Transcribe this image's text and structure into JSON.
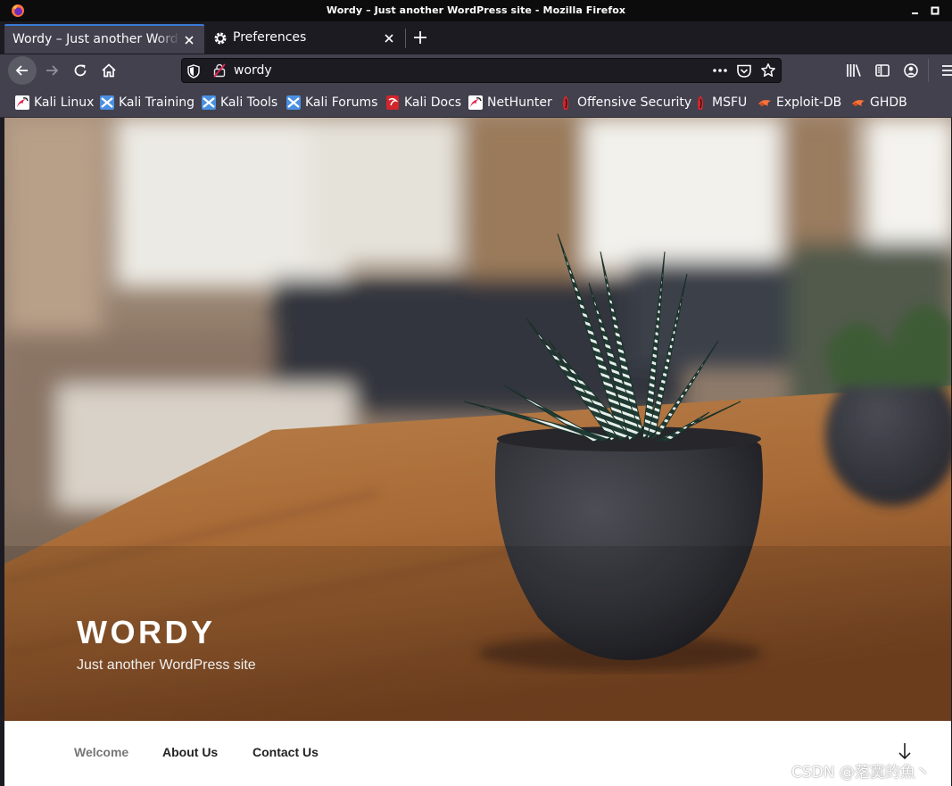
{
  "window": {
    "title": "Wordy – Just another WordPress site - Mozilla Firefox"
  },
  "tabs": [
    {
      "label": "Wordy – Just another WordPress site",
      "active": true
    },
    {
      "label": "Preferences",
      "active": false
    }
  ],
  "urlbar": {
    "value": "wordy"
  },
  "bookmarks": [
    {
      "label": "Kali Linux",
      "icon": "kali-dragon-icon"
    },
    {
      "label": "Kali Training",
      "icon": "kali-training-icon"
    },
    {
      "label": "Kali Tools",
      "icon": "kali-tools-icon"
    },
    {
      "label": "Kali Forums",
      "icon": "kali-forums-icon"
    },
    {
      "label": "Kali Docs",
      "icon": "kali-docs-icon"
    },
    {
      "label": "NetHunter",
      "icon": "nethunter-icon"
    },
    {
      "label": "Offensive Security",
      "icon": "offsec-icon"
    },
    {
      "label": "MSFU",
      "icon": "msfu-icon"
    },
    {
      "label": "Exploit-DB",
      "icon": "exploit-db-icon"
    },
    {
      "label": "GHDB",
      "icon": "ghdb-icon"
    }
  ],
  "site": {
    "title": "WORDY",
    "description": "Just another WordPress site",
    "nav": [
      {
        "label": "Welcome",
        "current": true
      },
      {
        "label": "About Us",
        "current": false
      },
      {
        "label": "Contact Us",
        "current": false
      }
    ]
  },
  "watermark": "CSDN @落寞的魚丶",
  "colors": {
    "chrome_dark": "#1c1b22",
    "chrome_toolbar": "#42414d",
    "active_tab_accent": "#3a7bd5",
    "site_nav_text": "#222222",
    "site_nav_current": "#767676"
  }
}
